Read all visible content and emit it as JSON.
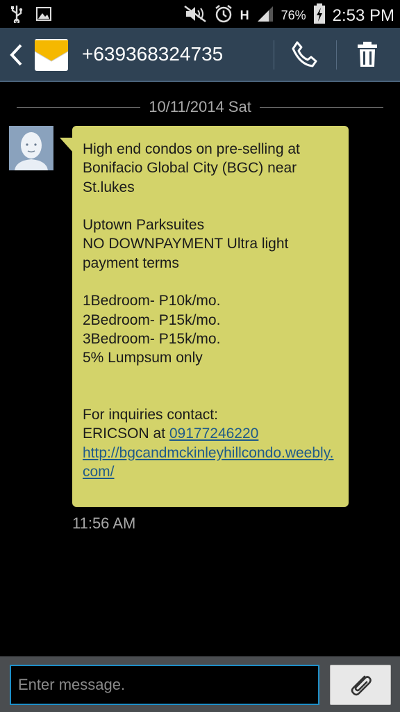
{
  "status_bar": {
    "battery": "76%",
    "time": "2:53 PM",
    "network": "H",
    "icons": [
      "usb-icon",
      "image-icon",
      "mute-icon",
      "alarm-icon",
      "signal-icon",
      "battery-charging-icon"
    ]
  },
  "header": {
    "contact": "+639368324735",
    "icons": [
      "back-icon",
      "envelope-icon",
      "call-icon",
      "trash-icon"
    ]
  },
  "thread": {
    "date": "10/11/2014 Sat",
    "message": {
      "line1": "High end condos on pre-selling at",
      "line2": "Bonifacio Global City (BGC) near",
      "line3": "St.lukes",
      "line4": "Uptown Parksuites",
      "line5": "NO DOWNPAYMENT Ultra light",
      "line6": "payment terms",
      "line7": "1Bedroom- P10k/mo.",
      "line8": "2Bedroom- P15k/mo.",
      "line9": "3Bedroom- P15k/mo.",
      "line10": "5% Lumpsum only",
      "line11": "For inquiries contact:",
      "contact_name": "ERICSON at ",
      "phone_link": "09177246220",
      "url_link": "http://bgcandmckinleyhillcondo.weebly.com/"
    },
    "timestamp": "11:56 AM"
  },
  "composer": {
    "placeholder": "Enter message.",
    "value": ""
  },
  "colors": {
    "header_bg": "#2f4254",
    "bubble_bg": "#d3d36a",
    "link": "#1e5a8a",
    "input_border": "#1e8fc8"
  }
}
